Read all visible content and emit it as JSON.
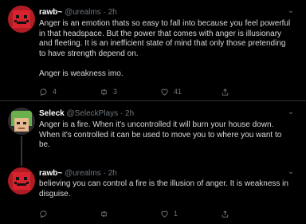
{
  "tweets": [
    {
      "name": "rawb~",
      "handle": "@urealms",
      "dot": "·",
      "time": "2h",
      "paragraphs": [
        "Anger is an emotion thats so easy to fall into because you feel powerful in that headspace. But the power that comes with anger is illusionary and fleeting. It is an inefficient state of mind that only those pretending to have strength depend on.",
        "Anger is weakness imo."
      ],
      "replies": "4",
      "retweets": "3",
      "likes": "41",
      "avatar": "red-pixel-face"
    },
    {
      "name": "Seleck",
      "handle": "@SeleckPlays",
      "dot": "·",
      "time": "2h",
      "paragraphs": [
        "Anger is a fire. When it's uncontrolled it will burn your house down. When it's controlled it can be used to move you to where you want to be."
      ],
      "replies": "",
      "retweets": "",
      "likes": "",
      "avatar": "green-hair-pixel-face"
    },
    {
      "name": "rawb~",
      "handle": "@urealms",
      "dot": "·",
      "time": "2h",
      "paragraphs": [
        "believing you can control a fire is the illusion of anger. It is weakness in disguise."
      ],
      "replies": "",
      "retweets": "",
      "likes": "1",
      "avatar": "red-pixel-face"
    }
  ],
  "icons": {
    "reply": "reply-icon",
    "retweet": "retweet-icon",
    "like": "heart-icon",
    "share": "share-icon",
    "more": "more-icon"
  },
  "more_label": "⌄",
  "colors": {
    "background": "#000000",
    "text": "#d9d9d9",
    "muted": "#6e767d",
    "name": "#ffffff",
    "avatar_red": "#c0202a",
    "avatar_green": "#6ab04c"
  }
}
